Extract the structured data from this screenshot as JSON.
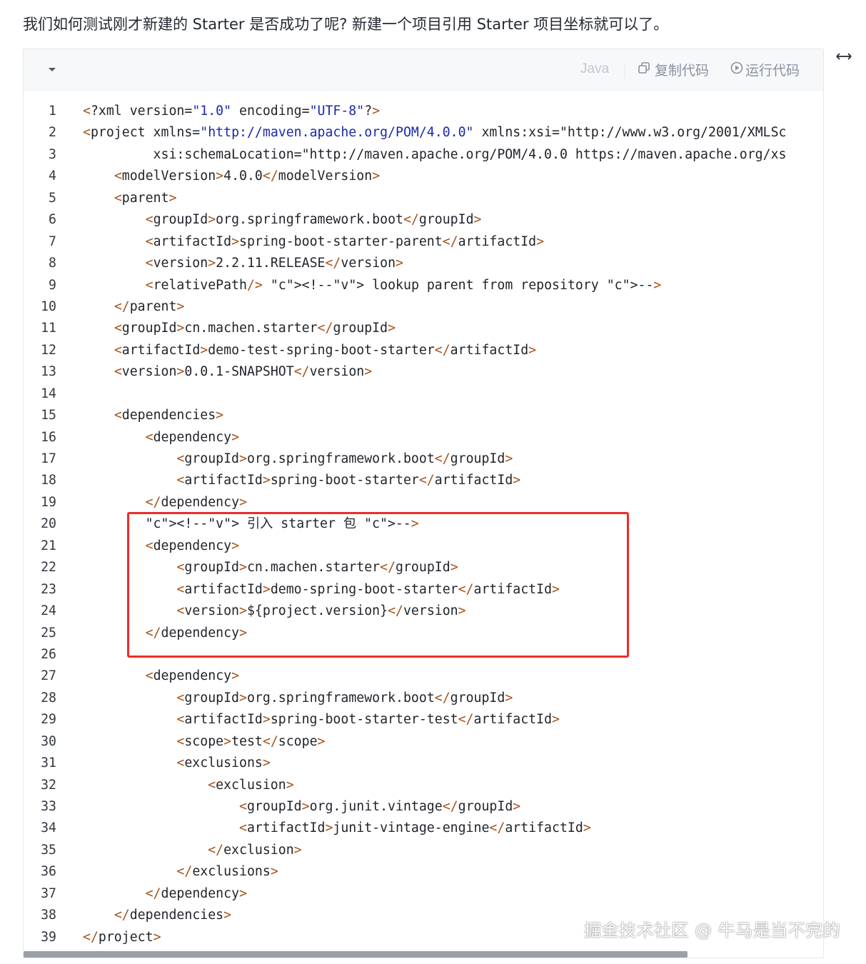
{
  "intro_text": "我们如何测试刚才新建的 Starter 是否成功了呢? 新建一个项目引用 Starter 项目坐标就可以了。",
  "toolbar": {
    "collapse_icon": "caret-down-icon",
    "language": "Java",
    "copy_icon": "copy-icon",
    "copy_label": "复制代码",
    "run_icon": "play-circle-icon",
    "run_label": "运行代码"
  },
  "expand_icon": "horizontal-expand-icon",
  "watermark": "掘金技术社区 @ 牛马是当不完的",
  "code_lines": [
    "<?xml version=\"1.0\" encoding=\"UTF-8\"?>",
    "<project xmlns=\"http://maven.apache.org/POM/4.0.0\" xmlns:xsi=\"http://www.w3.org/2001/XMLSc",
    "         xsi:schemaLocation=\"http://maven.apache.org/POM/4.0.0 https://maven.apache.org/xs",
    "    <modelVersion>4.0.0</modelVersion>",
    "    <parent>",
    "        <groupId>org.springframework.boot</groupId>",
    "        <artifactId>spring-boot-starter-parent</artifactId>",
    "        <version>2.2.11.RELEASE</version>",
    "        <relativePath/> <!-- lookup parent from repository -->",
    "    </parent>",
    "    <groupId>cn.machen.starter</groupId>",
    "    <artifactId>demo-test-spring-boot-starter</artifactId>",
    "    <version>0.0.1-SNAPSHOT</version>",
    "",
    "    <dependencies>",
    "        <dependency>",
    "            <groupId>org.springframework.boot</groupId>",
    "            <artifactId>spring-boot-starter</artifactId>",
    "        </dependency>",
    "        <!-- 引入 starter 包 -->",
    "        <dependency>",
    "            <groupId>cn.machen.starter</groupId>",
    "            <artifactId>demo-spring-boot-starter</artifactId>",
    "            <version>${project.version}</version>",
    "        </dependency>",
    "",
    "        <dependency>",
    "            <groupId>org.springframework.boot</groupId>",
    "            <artifactId>spring-boot-starter-test</artifactId>",
    "            <scope>test</scope>",
    "            <exclusions>",
    "                <exclusion>",
    "                    <groupId>org.junit.vintage</groupId>",
    "                    <artifactId>junit-vintage-engine</artifactId>",
    "                </exclusion>",
    "            </exclusions>",
    "        </dependency>",
    "    </dependencies>",
    "</project>"
  ]
}
